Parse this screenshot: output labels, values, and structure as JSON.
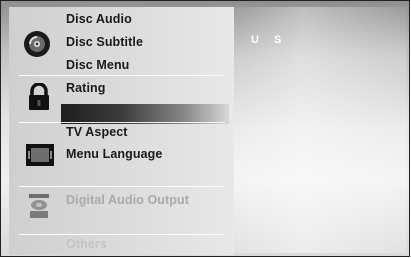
{
  "menu": {
    "disc_audio": "Disc Audio",
    "disc_subtitle": "Disc Subtitle",
    "disc_menu": "Disc Menu",
    "rating": "Rating",
    "tv_aspect": "TV Aspect",
    "menu_language": "Menu Language",
    "digital_audio_output": "Digital Audio Output",
    "others": "Others"
  },
  "setting": {
    "country_code": "U S"
  },
  "icons": [
    "disc-icon",
    "lock-icon",
    "tv-screen-icon",
    "speaker-icon"
  ],
  "colors": {
    "highlight_start": "#1e1e1e",
    "text": "#1a1a1a",
    "disabled_text": "#a9a9a9"
  }
}
